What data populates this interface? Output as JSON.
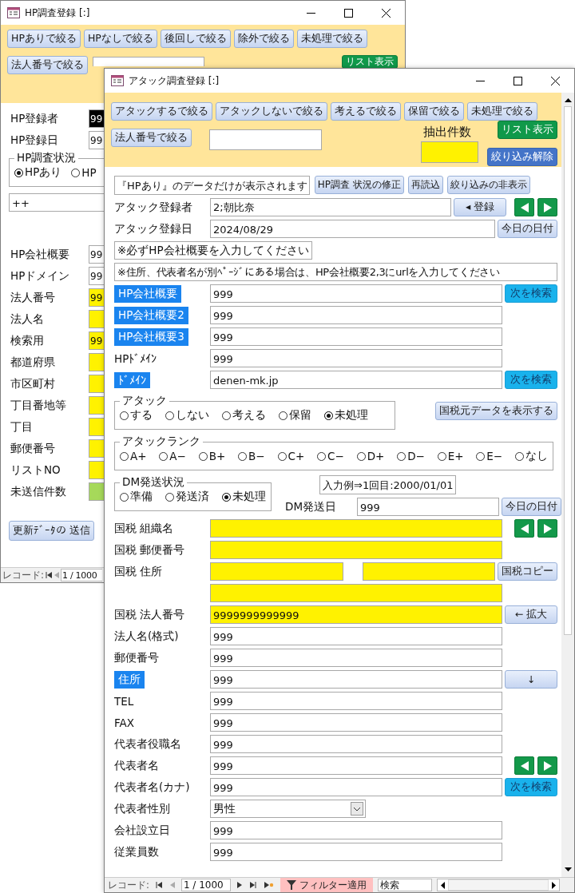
{
  "back_window": {
    "title": "HP調査登録 [:]",
    "filter_buttons": [
      "HPありで絞る",
      "HPなしで絞る",
      "後回しで絞る",
      "除外で絞る",
      "未処理で絞る"
    ],
    "corp_filter_button": "法人番号で絞る",
    "list_button": "リスト表示",
    "rows_top": [
      {
        "label": "HP登録者",
        "value": "99",
        "selected": true
      },
      {
        "label": "HP登録日",
        "value": "99",
        "selected": false
      }
    ],
    "status_group": {
      "legend": "HP調査状況",
      "options": [
        {
          "label": "HPあり",
          "selected": true
        },
        {
          "label": "HP",
          "selected": false
        }
      ]
    },
    "note_field": "++",
    "fields": [
      {
        "label": "HP会社概要",
        "kind": "plain",
        "value": "99"
      },
      {
        "label": "HPドメイン",
        "kind": "plain",
        "value": "99"
      },
      {
        "label": "法人番号",
        "kind": "tax",
        "value": "99"
      },
      {
        "label": "法人名",
        "kind": "tax"
      },
      {
        "label": "検索用",
        "kind": "tax",
        "value": "99"
      },
      {
        "label": "都道府県",
        "kind": "tax"
      },
      {
        "label": "市区町村",
        "kind": "tax"
      },
      {
        "label": "丁目番地等",
        "kind": "tax"
      },
      {
        "label": "丁目",
        "kind": "tax"
      },
      {
        "label": "郵便番号",
        "kind": "tax"
      },
      {
        "label": "リストNO",
        "kind": "tax"
      },
      {
        "label": "未送信件数",
        "kind": "count"
      }
    ],
    "send_button": "更新ﾃﾞｰﾀの 送信",
    "record_label": "レコード:",
    "record_position": "1 / 1000"
  },
  "front_window": {
    "title": "アタック調査登録 [:]",
    "filter_buttons": [
      "アタックするで絞る",
      "アタックしないで絞る",
      "考えるで絞る",
      "保留で絞る",
      "未処理で絞る"
    ],
    "corp_filter_button": "法人番号で絞る",
    "count_label": "抽出件数",
    "list_button": "リスト表示",
    "clear_button": "絞り込み解除",
    "body": [
      {
        "kind": "notice",
        "text": "『HPあり』のデータだけが表示されます",
        "buttons": [
          "HP調査 状況の修正",
          "再読込",
          "絞り込みの非表示"
        ]
      },
      {
        "kind": "row",
        "label": "アタック登録者",
        "highlighted": false,
        "fields": [
          {
            "kind": "plain",
            "value": "2;朝比奈"
          }
        ],
        "buttons": [
          {
            "kind": "std",
            "text": "◂ 登録"
          },
          {
            "kind": "nav"
          }
        ]
      },
      {
        "kind": "row",
        "label": "アタック登録日",
        "highlighted": false,
        "fields": [
          {
            "kind": "plain",
            "value": "2024/08/29"
          }
        ],
        "buttons": [
          {
            "kind": "std",
            "text": "今日の日付"
          }
        ]
      },
      {
        "kind": "note",
        "text": "※必ずHP会社概要を入力してください"
      },
      {
        "kind": "note",
        "text": "※住所、代表者名が別ﾍﾟｰｼﾞにある場合は、HP会社概要2,3にurlを入力してください"
      },
      {
        "kind": "row",
        "label": "HP会社概要",
        "highlighted": true,
        "fields": [
          {
            "kind": "plain",
            "value": "999"
          }
        ],
        "buttons": [
          {
            "kind": "search",
            "text": "次を検索"
          }
        ]
      },
      {
        "kind": "row",
        "label": "HP会社概要2",
        "highlighted": true,
        "fields": [
          {
            "kind": "plain",
            "value": "999"
          }
        ]
      },
      {
        "kind": "row",
        "label": "HP会社概要3",
        "highlighted": true,
        "fields": [
          {
            "kind": "plain",
            "value": "999"
          }
        ]
      },
      {
        "kind": "row",
        "label": "HPﾄﾞﾒｲﾝ",
        "highlighted": false,
        "fields": [
          {
            "kind": "plain",
            "value": "999"
          }
        ]
      },
      {
        "kind": "row",
        "label": "ﾄﾞﾒｲﾝ",
        "highlighted": true,
        "fields": [
          {
            "kind": "plain",
            "value": "denen-mk.jp"
          }
        ],
        "buttons": [
          {
            "kind": "search",
            "text": "次を検索"
          }
        ]
      },
      {
        "kind": "radio_group",
        "legend": "アタック",
        "options": [
          {
            "label": "する",
            "selected": false
          },
          {
            "label": "しない",
            "selected": false
          },
          {
            "label": "考える",
            "selected": false
          },
          {
            "label": "保留",
            "selected": false
          },
          {
            "label": "未処理",
            "selected": true
          }
        ],
        "button": "国税元データを表示する"
      },
      {
        "kind": "radio_group",
        "legend": "アタックランク",
        "options": [
          {
            "label": "A+",
            "selected": false
          },
          {
            "label": "A−",
            "selected": false
          },
          {
            "label": "B+",
            "selected": false
          },
          {
            "label": "B−",
            "selected": false
          },
          {
            "label": "C+",
            "selected": false
          },
          {
            "label": "C−",
            "selected": false
          },
          {
            "label": "D+",
            "selected": false
          },
          {
            "label": "D−",
            "selected": false
          },
          {
            "label": "E+",
            "selected": false
          },
          {
            "label": "E−",
            "selected": false
          },
          {
            "label": "なし",
            "selected": false
          }
        ]
      },
      {
        "kind": "dm_group",
        "legend": "DM発送状況",
        "options": [
          {
            "label": "準備",
            "selected": false
          },
          {
            "label": "発送済",
            "selected": false
          },
          {
            "label": "未処理",
            "selected": true
          }
        ],
        "example": "入力例⇒1回目:2000/01/01",
        "date_label": "DM発送日",
        "date_value": "999",
        "date_button": "今日の日付"
      },
      {
        "kind": "row",
        "label": "国税 組織名",
        "highlighted": false,
        "fields": [
          {
            "kind": "tax"
          }
        ],
        "buttons": [
          {
            "kind": "nav"
          }
        ]
      },
      {
        "kind": "row",
        "label": "国税 郵便番号",
        "highlighted": false,
        "fields": [
          {
            "kind": "tax"
          }
        ]
      },
      {
        "kind": "row",
        "label": "国税 住所",
        "highlighted": false,
        "fields": [
          {
            "kind": "tax"
          },
          {
            "kind": "tax"
          }
        ],
        "buttons": [
          {
            "kind": "std",
            "text": "国税コピー"
          }
        ]
      },
      {
        "kind": "row",
        "fields": [
          {
            "kind": "tax"
          }
        ]
      },
      {
        "kind": "row",
        "label": "国税 法人番号",
        "highlighted": false,
        "fields": [
          {
            "kind": "tax",
            "value": "9999999999999"
          }
        ],
        "buttons": [
          {
            "kind": "std",
            "text": "← 拡大"
          }
        ]
      },
      {
        "kind": "row",
        "label": "法人名(格式)",
        "highlighted": false,
        "fields": [
          {
            "kind": "plain",
            "value": "999"
          }
        ]
      },
      {
        "kind": "row",
        "label": "郵便番号",
        "highlighted": false,
        "fields": [
          {
            "kind": "plain",
            "value": "999"
          }
        ]
      },
      {
        "kind": "row",
        "label": "住所",
        "highlighted": true,
        "fields": [
          {
            "kind": "plain",
            "value": "999"
          }
        ],
        "buttons": [
          {
            "kind": "std",
            "text": "↓"
          }
        ]
      },
      {
        "kind": "row",
        "label": "TEL",
        "highlighted": false,
        "fields": [
          {
            "kind": "plain",
            "value": "999"
          }
        ]
      },
      {
        "kind": "row",
        "label": "FAX",
        "highlighted": false,
        "fields": [
          {
            "kind": "plain",
            "value": "999"
          }
        ]
      },
      {
        "kind": "row",
        "label": "代表者役職名",
        "highlighted": false,
        "fields": [
          {
            "kind": "plain",
            "value": "999"
          }
        ]
      },
      {
        "kind": "row",
        "label": "代表者名",
        "highlighted": false,
        "fields": [
          {
            "kind": "plain",
            "value": "999"
          }
        ],
        "buttons": [
          {
            "kind": "nav"
          }
        ]
      },
      {
        "kind": "row",
        "label": "代表者名(カナ)",
        "highlighted": false,
        "fields": [
          {
            "kind": "plain",
            "value": "999"
          }
        ],
        "buttons": [
          {
            "kind": "search",
            "text": "次を検索"
          }
        ]
      },
      {
        "kind": "row",
        "label": "代表者性別",
        "highlighted": false,
        "fields": [
          {
            "kind": "select",
            "value": "男性"
          }
        ]
      },
      {
        "kind": "row",
        "label": "会社設立日",
        "highlighted": false,
        "fields": [
          {
            "kind": "plain",
            "value": "999"
          }
        ]
      },
      {
        "kind": "row",
        "label": "従業員数",
        "highlighted": false,
        "fields": [
          {
            "kind": "plain",
            "value": "999"
          }
        ]
      }
    ],
    "record_label": "レコード:",
    "record_position": "1 / 1000",
    "filter_status": "フィルター適用",
    "search_placeholder": "検索"
  }
}
